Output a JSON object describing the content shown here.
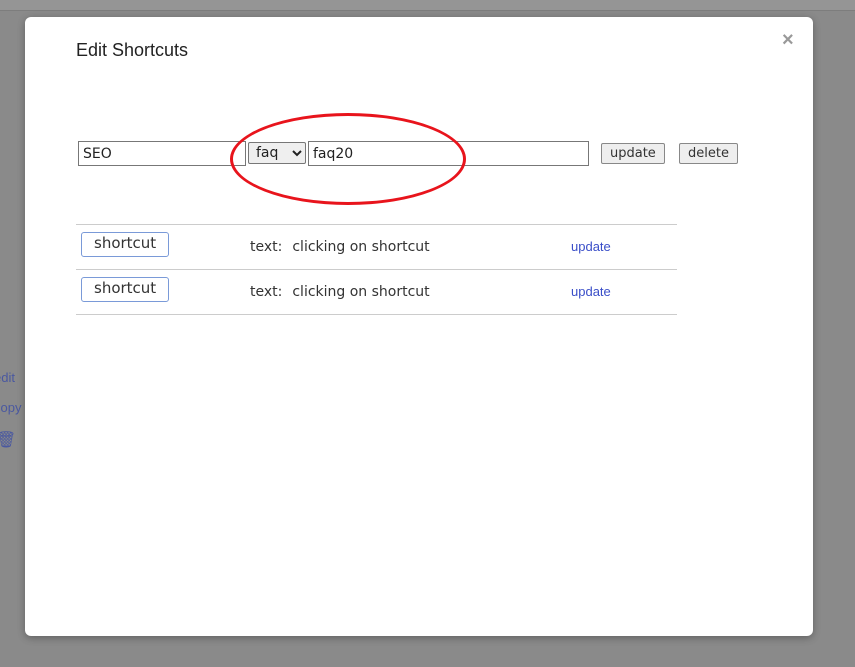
{
  "background": {
    "links": [
      "edit",
      "copy"
    ]
  },
  "modal": {
    "title": "Edit Shortcuts",
    "close": "×",
    "form": {
      "name_value": "SEO",
      "type_selected": "faq",
      "value": "faq20",
      "update_label": "update",
      "delete_label": "delete"
    },
    "annotation_color": "#e8141c",
    "rows": [
      {
        "chip": "shortcut",
        "label": "text:",
        "text": "clicking on shortcut",
        "action": "update"
      },
      {
        "chip": "shortcut",
        "label": "text:",
        "text": "clicking on shortcut",
        "action": "update"
      }
    ]
  }
}
